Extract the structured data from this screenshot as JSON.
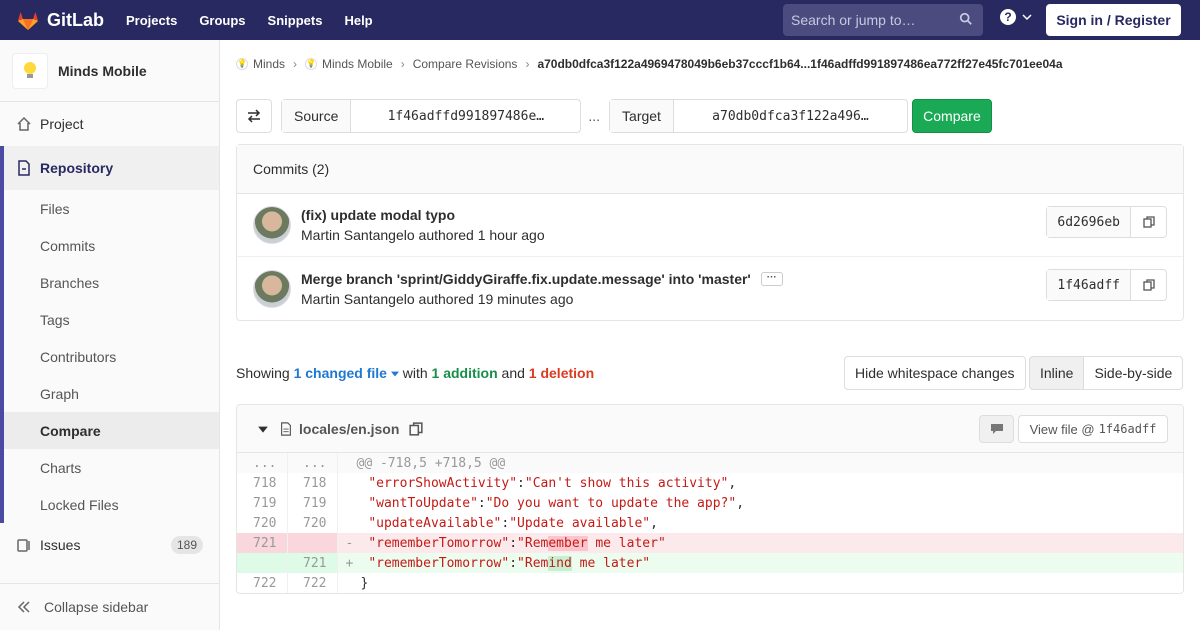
{
  "nav": {
    "logo_text": "GitLab",
    "links": [
      "Projects",
      "Groups",
      "Snippets",
      "Help"
    ],
    "search_placeholder": "Search or jump to…",
    "signin_label": "Sign in / Register",
    "bg_color": "#292961"
  },
  "sidebar": {
    "project_name": "Minds Mobile",
    "project_label": "Project",
    "repository_label": "Repository",
    "repo_items": [
      "Files",
      "Commits",
      "Branches",
      "Tags",
      "Contributors",
      "Graph",
      "Compare",
      "Charts",
      "Locked Files"
    ],
    "active_item": "Compare",
    "issues_label": "Issues",
    "issues_count": "189",
    "collapse_label": "Collapse sidebar"
  },
  "breadcrumb": {
    "items": [
      "Minds",
      "Minds Mobile",
      "Compare Revisions"
    ],
    "current": "a70db0dfca3f122a4969478049b6eb37cccf1b64...1f46adffd991897486ea772ff27e45fc701ee04a"
  },
  "compare": {
    "source_label": "Source",
    "source_value": "1f46adffd991897486e…",
    "separator": "...",
    "target_label": "Target",
    "target_value": "a70db0dfca3f122a496…",
    "compare_label": "Compare"
  },
  "commits": {
    "header": "Commits (2)",
    "items": [
      {
        "title": "(fix) update modal typo",
        "author": "Martin Santangelo",
        "meta": "authored 1 hour ago",
        "sha": "6d2696eb",
        "has_more": false
      },
      {
        "title": "Merge branch 'sprint/GiddyGiraffe.fix.update.message' into 'master'",
        "author": "Martin Santangelo",
        "meta": "authored 19 minutes ago",
        "sha": "1f46adff",
        "has_more": true
      }
    ]
  },
  "stats": {
    "showing": "Showing",
    "changed": "1 changed file",
    "with": "with",
    "additions": "1 addition",
    "and": "and",
    "deletions": "1 deletion",
    "whitespace_btn": "Hide whitespace changes",
    "inline_btn": "Inline",
    "sidebyside_btn": "Side-by-side"
  },
  "file": {
    "path": "locales/en.json",
    "view_file_label": "View file @",
    "view_file_sha": "1f46adff",
    "lines": [
      {
        "type": "match",
        "old": "...",
        "new": "...",
        "code": "@@ -718,5 +718,5 @@"
      },
      {
        "type": "context",
        "old": "718",
        "new": "718",
        "key": "\"errorShowActivity\"",
        "val": "\"Can't show this activity\"",
        "tail": ","
      },
      {
        "type": "context",
        "old": "719",
        "new": "719",
        "key": "\"wantToUpdate\"",
        "val": "\"Do you want to update the app?\"",
        "tail": ","
      },
      {
        "type": "context",
        "old": "720",
        "new": "720",
        "key": "\"updateAvailable\"",
        "val": "\"Update available\"",
        "tail": ","
      },
      {
        "type": "del",
        "old": "721",
        "new": "",
        "key": "\"rememberTomorrow\"",
        "val_pre": "\"Rem",
        "val_hl": "ember",
        "val_post": " me later\""
      },
      {
        "type": "add",
        "old": "",
        "new": "721",
        "key": "\"rememberTomorrow\"",
        "val_pre": "\"Rem",
        "val_hl": "ind",
        "val_post": " me later\""
      },
      {
        "type": "context",
        "old": "722",
        "new": "722",
        "code": "}"
      }
    ]
  }
}
